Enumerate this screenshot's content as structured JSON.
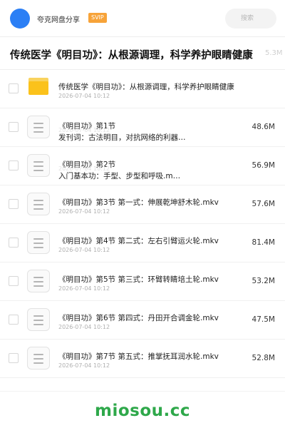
{
  "header": {
    "app_name": "夸克网盘分享",
    "badge": "SVIP",
    "search_placeholder": "搜索",
    "accent_color": "#2b7ff5"
  },
  "page": {
    "title": "传统医学《明目功》：从根源调理，科学养护眼睛健康",
    "title_size": "5.3M"
  },
  "items": [
    {
      "type": "folder",
      "icon": "folder-icon",
      "name": "传统医学《明目功》：从根源调理，科学养护眼睛健康",
      "date": "2026-07-04 10:12",
      "size": ""
    },
    {
      "type": "file",
      "icon": "file-icon",
      "name": "《明目功》第1节",
      "name2": "发刊词：古法明目，对抗网络的利器…",
      "date": "2026-07-04 10:12",
      "size": "48.6M"
    },
    {
      "type": "file",
      "icon": "file-icon",
      "name": "《明目功》第2节",
      "name2": "入门基本功：手型、步型和呼吸.m…",
      "date": "2026-07-04 10:12",
      "size": "56.9M"
    },
    {
      "type": "file",
      "icon": "file-icon",
      "name": "《明目功》第3节 第一式：伸展乾坤舒木轮.mkv",
      "date": "2026-07-04 10:12",
      "size": "57.6M"
    },
    {
      "type": "file",
      "icon": "file-icon",
      "name": "《明目功》第4节 第二式：左右引臂运火轮.mkv",
      "date": "2026-07-04 10:12",
      "size": "81.4M"
    },
    {
      "type": "file",
      "icon": "file-icon",
      "name": "《明目功》第5节 第三式：环臂转睛培土轮.mkv",
      "date": "2026-07-04 10:12",
      "size": "53.2M"
    },
    {
      "type": "file",
      "icon": "file-icon",
      "name": "《明目功》第6节 第四式：丹田开合调金轮.mkv",
      "date": "2026-07-04 10:12",
      "size": "47.5M"
    },
    {
      "type": "file",
      "icon": "file-icon",
      "name": "《明目功》第7节 第五式：推掌抚耳润水轮.mkv",
      "date": "2026-07-04 10:12",
      "size": "52.8M"
    }
  ],
  "footer": {
    "watermark": "miosou.cc",
    "watermark_color": "#2ea84a"
  }
}
